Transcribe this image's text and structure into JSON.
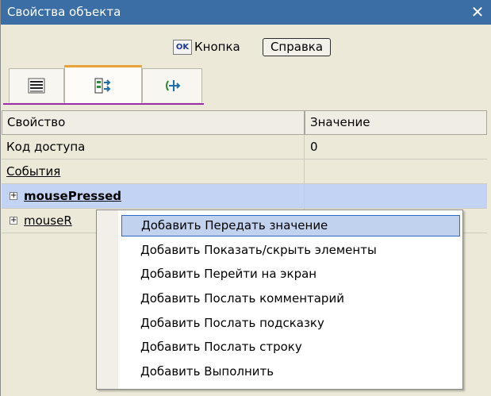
{
  "window": {
    "title": "Свойства объекта",
    "close_symbol": "✕"
  },
  "toolbar": {
    "ok_icon_text": "OK",
    "button_label": "Кнопка",
    "help_label": "Справка"
  },
  "tabs": [
    {
      "icon": "properties-list-icon"
    },
    {
      "icon": "events-icon"
    },
    {
      "icon": "move-icon"
    }
  ],
  "grid": {
    "headers": {
      "property": "Свойство",
      "value": "Значение"
    },
    "rows": [
      {
        "property": "Код доступа",
        "value": "0"
      },
      {
        "property": "События",
        "value": ""
      },
      {
        "property": "mousePressed",
        "value": ""
      },
      {
        "property": "mouseR",
        "value": ""
      }
    ]
  },
  "context_menu": {
    "items": [
      "Добавить Передать значение",
      "Добавить Показать/скрыть элементы",
      "Добавить Перейти на экран",
      "Добавить Послать комментарий",
      "Добавить Послать подсказку",
      "Добавить Послать строку",
      "Добавить Выполнить"
    ]
  },
  "colors": {
    "titlebar": "#3a6ea5",
    "selection": "#c3d3f4",
    "menu_highlight": "#c1d2ee",
    "tab_accent": "#e8a33d"
  }
}
